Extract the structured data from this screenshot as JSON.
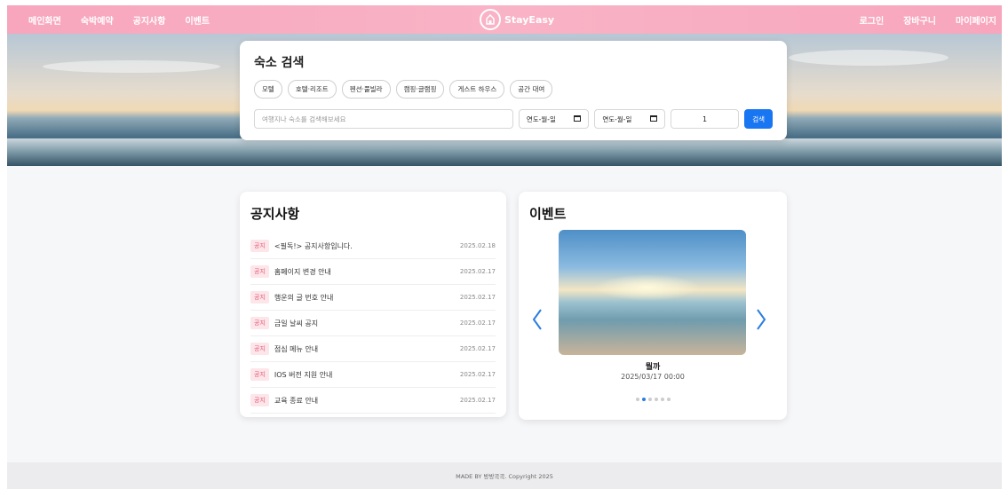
{
  "header": {
    "nav_left": [
      "메인화면",
      "숙박예약",
      "공지사항",
      "이벤트"
    ],
    "brand": "StayEasy",
    "nav_right": [
      "로그인",
      "장바구니",
      "마이페이지"
    ]
  },
  "search": {
    "title": "숙소 검색",
    "categories": [
      "모텔",
      "호텔·리조트",
      "펜션·풀빌라",
      "캠핑·글램핑",
      "게스트 하우스",
      "공간 대여"
    ],
    "placeholder": "여행지나 숙소를 검색해보세요",
    "checkin": "연도-월-일",
    "checkout": "연도-월-일",
    "guests": "1",
    "button": "검색"
  },
  "notice": {
    "title": "공지사항",
    "badge": "공지",
    "items": [
      {
        "text": "<필독!> 공지사항입니다.",
        "date": "2025.02.18"
      },
      {
        "text": "홈페이지 변경 안내",
        "date": "2025.02.17"
      },
      {
        "text": "행운의 글 번호 안내",
        "date": "2025.02.17"
      },
      {
        "text": "금일 날씨 공지",
        "date": "2025.02.17"
      },
      {
        "text": "점심 메뉴 안내",
        "date": "2025.02.17"
      },
      {
        "text": "IOS 버전 지원 안내",
        "date": "2025.02.17"
      },
      {
        "text": "교육 종료 안내",
        "date": "2025.02.17"
      }
    ]
  },
  "event": {
    "title": "이벤트",
    "name": "뭘까",
    "date": "2025/03/17 00:00",
    "slides": 6,
    "active": 1
  },
  "footer": {
    "text": "MADE BY 방방곡곡. Copyright 2025"
  },
  "colors": {
    "header": "#f7a6bd",
    "accent": "#1976f2",
    "badge": "#e65a77"
  }
}
